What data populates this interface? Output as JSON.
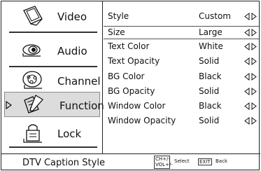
{
  "sidebar": {
    "items": [
      {
        "label": "Video",
        "icon": "video-icon",
        "selected": false
      },
      {
        "label": "Audio",
        "icon": "audio-icon",
        "selected": false
      },
      {
        "label": "Channel",
        "icon": "channel-icon",
        "selected": false
      },
      {
        "label": "Function",
        "icon": "function-icon",
        "selected": true
      },
      {
        "label": "Lock",
        "icon": "lock-icon",
        "selected": false
      }
    ]
  },
  "settings": {
    "rows": [
      {
        "name": "Style",
        "value": "Custom",
        "selected": false
      },
      {
        "name": "Size",
        "value": "Large",
        "selected": true
      },
      {
        "name": "Text Color",
        "value": "White",
        "selected": false
      },
      {
        "name": "Text Opacity",
        "value": "Solid",
        "selected": false
      },
      {
        "name": "BG Color",
        "value": "Black",
        "selected": false
      },
      {
        "name": "BG Opacity",
        "value": "Solid",
        "selected": false
      },
      {
        "name": "Window Color",
        "value": "Black",
        "selected": false
      },
      {
        "name": "Window Opacity",
        "value": "Solid",
        "selected": false
      }
    ]
  },
  "footer": {
    "title": "DTV Caption Style",
    "ch_key_line1": "CH+/-",
    "ch_key_line2": "VOL+/-",
    "select_label": "Select",
    "exit_key": "EXIT",
    "back_label": "Back"
  },
  "colors": {
    "selected_background": "#dcdcdc",
    "border": "#222222"
  }
}
